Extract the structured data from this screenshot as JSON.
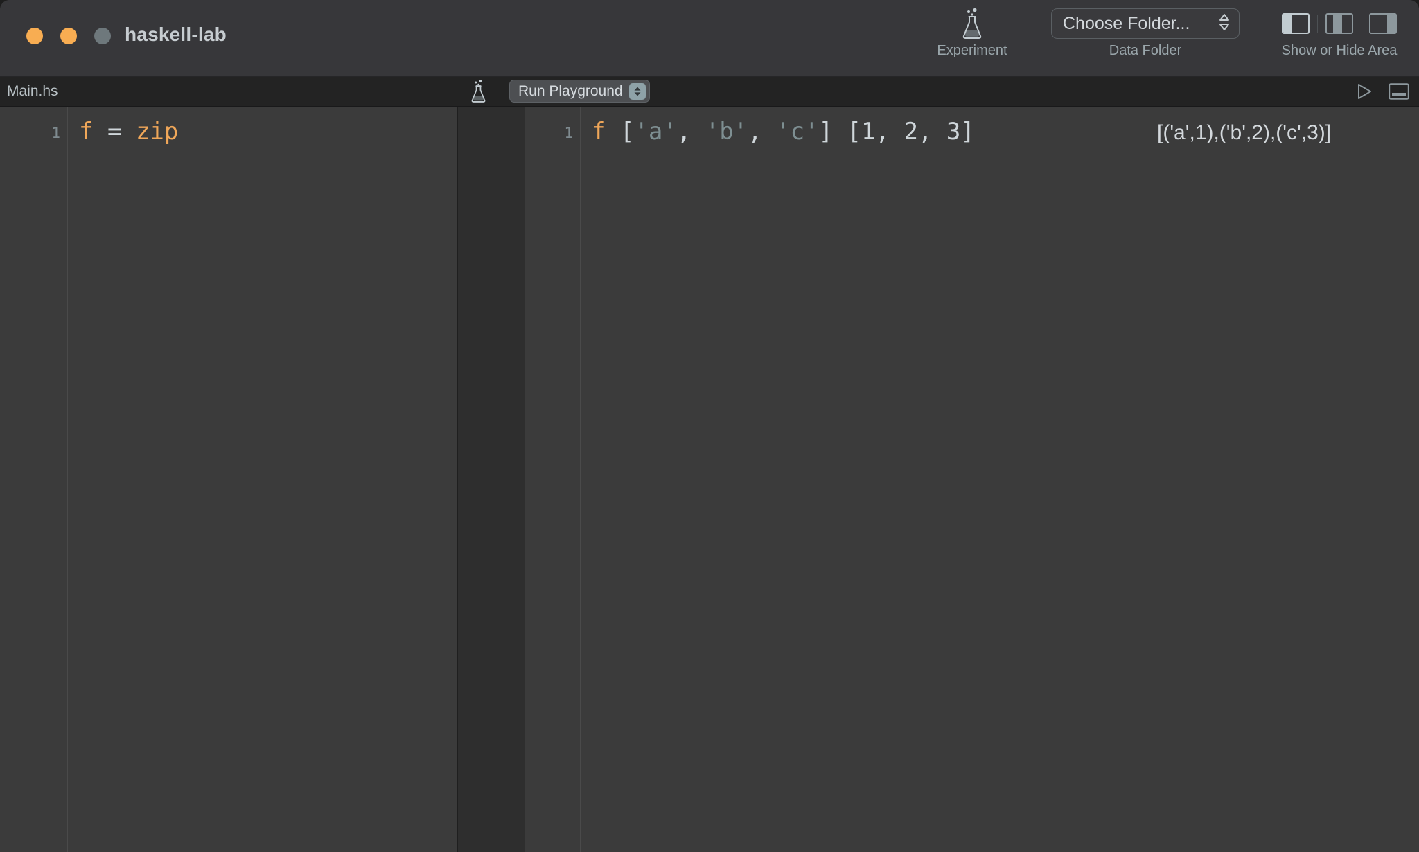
{
  "window": {
    "title": "haskell-lab",
    "traffic_lights": [
      {
        "name": "close",
        "color": "#f8ad52"
      },
      {
        "name": "minimize",
        "color": "#f8ad52"
      },
      {
        "name": "zoom",
        "color": "#6e787c"
      }
    ]
  },
  "toolbar": {
    "experiment": {
      "icon": "flask-icon",
      "label": "Experiment"
    },
    "data_folder": {
      "popup_value": "Choose Folder...",
      "label": "Data Folder"
    },
    "show_or_hide_area": {
      "label": "Show or Hide Area",
      "toggles": [
        {
          "name": "left-panel",
          "active": true
        },
        {
          "name": "center-panel",
          "active": false
        },
        {
          "name": "right-panel",
          "active": false
        }
      ]
    }
  },
  "subbar": {
    "file_name": "Main.hs",
    "flask_icon": "flask-icon",
    "run_popup_label": "Run Playground",
    "run_button_icon": "play-triangle-icon",
    "bottom_panel_icon": "bottom-panel-icon"
  },
  "editor": {
    "line_numbers": [
      "1"
    ],
    "lines": [
      {
        "tokens": [
          {
            "text": "f",
            "type": "fn"
          },
          {
            "text": " ",
            "type": "punct"
          },
          {
            "text": "=",
            "type": "op"
          },
          {
            "text": " ",
            "type": "punct"
          },
          {
            "text": "zip",
            "type": "fn"
          }
        ]
      }
    ]
  },
  "playground": {
    "line_numbers": [
      "1"
    ],
    "lines": [
      {
        "tokens": [
          {
            "text": "f",
            "type": "fn"
          },
          {
            "text": " [",
            "type": "punct"
          },
          {
            "text": "'a'",
            "type": "char"
          },
          {
            "text": ", ",
            "type": "punct"
          },
          {
            "text": "'b'",
            "type": "char"
          },
          {
            "text": ", ",
            "type": "punct"
          },
          {
            "text": "'c'",
            "type": "char"
          },
          {
            "text": "] [",
            "type": "punct"
          },
          {
            "text": "1",
            "type": "num"
          },
          {
            "text": ", ",
            "type": "punct"
          },
          {
            "text": "2",
            "type": "num"
          },
          {
            "text": ", ",
            "type": "punct"
          },
          {
            "text": "3",
            "type": "num"
          },
          {
            "text": "]",
            "type": "punct"
          }
        ]
      }
    ]
  },
  "output": {
    "result": "[('a',1),('b',2),('c',3)]"
  },
  "colors": {
    "window_bg": "#3b3b3b",
    "titlebar_bg": "#37373a",
    "subbar_bg": "#232323",
    "splitter_bg": "#2e2e2e",
    "accent_orange": "#f0a759",
    "text_primary": "#d4d9dd",
    "text_muted": "#9aa6ab"
  }
}
